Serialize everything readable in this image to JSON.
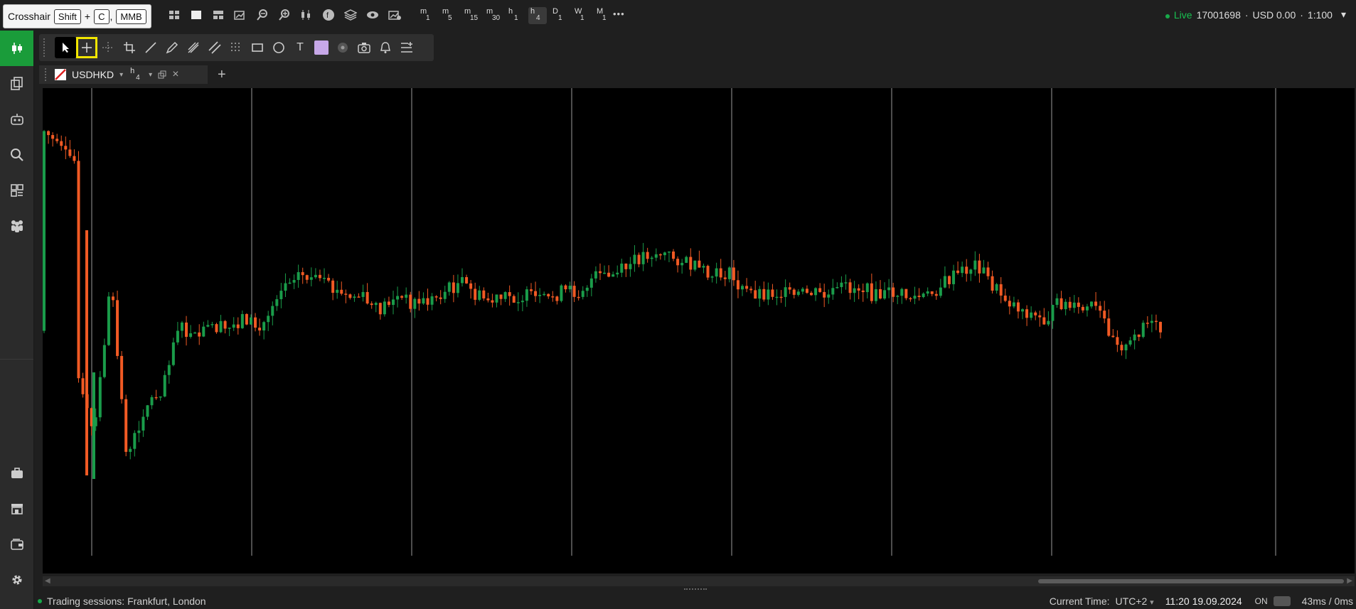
{
  "tooltip": {
    "label": "Crosshair",
    "key1": "Shift",
    "plus": "+",
    "key2": "C",
    "comma": ",",
    "key3": "MMB"
  },
  "timeframes": [
    {
      "letter": "m",
      "num": "1"
    },
    {
      "letter": "m",
      "num": "5"
    },
    {
      "letter": "m",
      "num": "15"
    },
    {
      "letter": "m",
      "num": "30"
    },
    {
      "letter": "h",
      "num": "1"
    },
    {
      "letter": "h",
      "num": "4"
    },
    {
      "letter": "D",
      "num": "1"
    },
    {
      "letter": "W",
      "num": "1"
    },
    {
      "letter": "M",
      "num": "1"
    }
  ],
  "more": "•••",
  "account": {
    "status": "Live",
    "number": "17001698",
    "balance": "USD 0.00",
    "leverage": "1:100",
    "chevron": "▾"
  },
  "drawing_text_tool": "T",
  "chart_tab": {
    "symbol": "USDHKD",
    "tf_letter": "h",
    "tf_num": "4",
    "dropdown": "▾",
    "add": "+",
    "close": "×"
  },
  "status": {
    "sessions": "Trading sessions: Frankfurt, London",
    "current_time_label": "Current Time:",
    "tz": "UTC+2",
    "tz_arrow": "▾",
    "datetime": "11:20 19.09.2024",
    "on": "ON",
    "latency": "43ms / 0ms"
  },
  "colors": {
    "up": "#1a9c4a",
    "down": "#f15a24",
    "accent": "#1a9c3a",
    "highlight": "#f2e600",
    "swatch": "#c7a8e8"
  },
  "chart_data": {
    "type": "candlestick",
    "symbol": "USDHKD",
    "timeframe": "h4",
    "close_levels": [
      0.5,
      0.53,
      0.6,
      0.72,
      0.4,
      0.77,
      0.66,
      0.62,
      0.49,
      0.52,
      0.49,
      0.5,
      0.47,
      0.5,
      0.42,
      0.38,
      0.39,
      0.41,
      0.43,
      0.43,
      0.46,
      0.43,
      0.44,
      0.44,
      0.42,
      0.4,
      0.43,
      0.44,
      0.43,
      0.43,
      0.44,
      0.42,
      0.42,
      0.39,
      0.39,
      0.37,
      0.34,
      0.34,
      0.35,
      0.37,
      0.39,
      0.38,
      0.42,
      0.42,
      0.42,
      0.43,
      0.42,
      0.43,
      0.41,
      0.41,
      0.43,
      0.42,
      0.43,
      0.43,
      0.4,
      0.38,
      0.36,
      0.41,
      0.44,
      0.46,
      0.48,
      0.44,
      0.46,
      0.45,
      0.5,
      0.54,
      0.48,
      0.5
    ]
  }
}
